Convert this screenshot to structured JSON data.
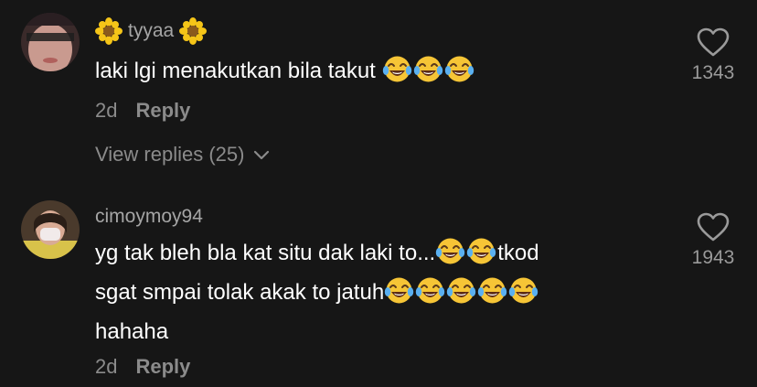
{
  "comments": [
    {
      "username": "tyyaa",
      "text_lines": [
        "laki lgi menakutkan bila takut"
      ],
      "time": "2d",
      "reply_label": "Reply",
      "view_replies_label": "View replies (25)",
      "likes": "1343",
      "icon": "heart-outline-icon"
    },
    {
      "username": "cimoymoy94",
      "text_lines": [
        "yg tak bleh bla kat situ dak laki to...",
        "tkod",
        "sgat smpai tolak akak to jatuh",
        "hahaha"
      ],
      "time": "2d",
      "reply_label": "Reply",
      "likes": "1943",
      "icon": "heart-outline-icon"
    }
  ],
  "colors": {
    "background": "#161616",
    "username": "#a5a5a5",
    "secondary": "#8b8b8b"
  }
}
